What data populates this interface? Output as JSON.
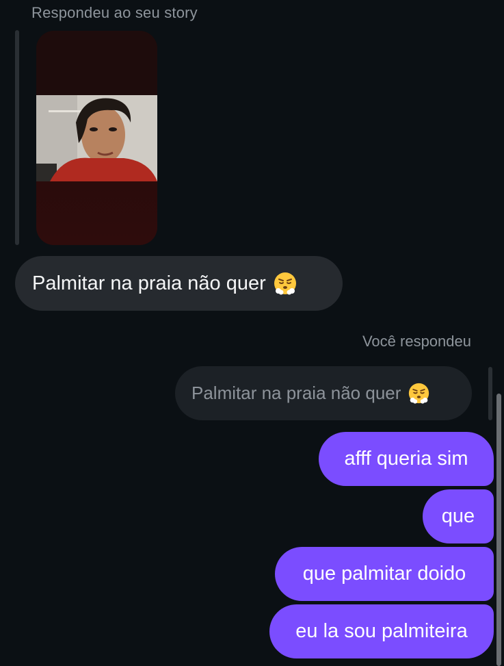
{
  "story_reply": {
    "caption": "Respondeu ao seu story",
    "message": "Palmitar na praia não quer",
    "emoji_icon": "face-with-steam-from-nose-icon"
  },
  "my_reply": {
    "caption": "Você respondeu",
    "quoted_message": "Palmitar na praia não quer",
    "emoji_icon": "face-with-steam-from-nose-icon"
  },
  "sent_messages": [
    {
      "text": "afff queria sim"
    },
    {
      "text": "que"
    },
    {
      "text": "que palmitar doido"
    },
    {
      "text": "eu la sou palmiteira"
    }
  ],
  "colors": {
    "background": "#0b1014",
    "received_bubble": "#262a2f",
    "quoted_bubble": "#1c2126",
    "sent_bubble": "#7b4dff"
  }
}
